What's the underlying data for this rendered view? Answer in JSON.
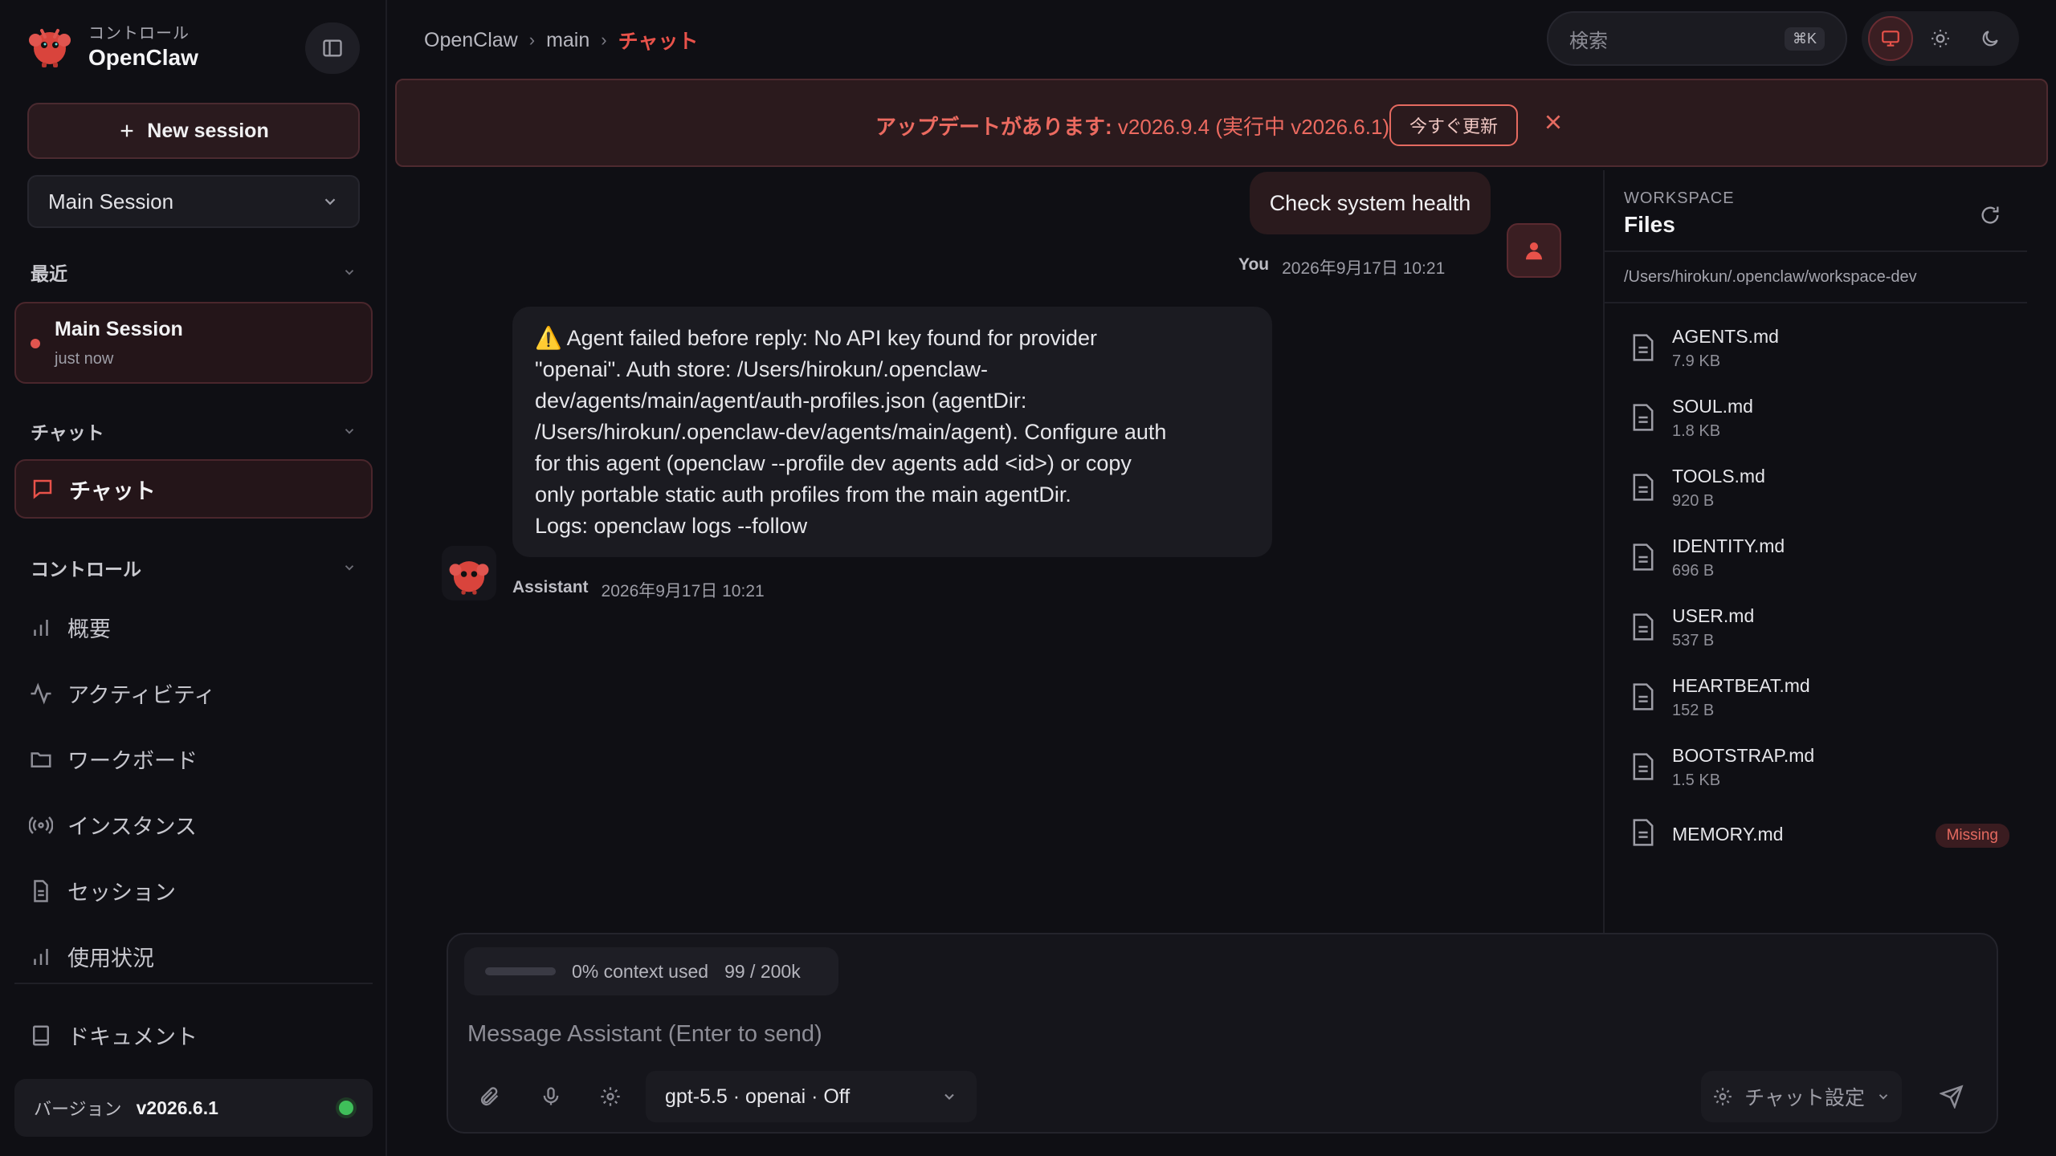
{
  "brand": {
    "subtitle": "コントロール",
    "title": "OpenClaw"
  },
  "sidebar": {
    "new_session_label": "New session",
    "session_select_value": "Main Session",
    "recent": {
      "heading": "最近",
      "item": {
        "title": "Main Session",
        "time": "just now"
      }
    },
    "chat": {
      "heading": "チャット",
      "item_label": "チャット"
    },
    "control": {
      "heading": "コントロール",
      "items": [
        {
          "label": "概要",
          "icon": "bar-chart-icon"
        },
        {
          "label": "アクティビティ",
          "icon": "activity-icon"
        },
        {
          "label": "ワークボード",
          "icon": "folder-icon"
        },
        {
          "label": "インスタンス",
          "icon": "broadcast-icon"
        },
        {
          "label": "セッション",
          "icon": "document-icon"
        },
        {
          "label": "使用状況",
          "icon": "bar-chart-icon"
        }
      ]
    },
    "docs_label": "ドキュメント",
    "version": {
      "label": "バージョン",
      "value": "v2026.6.1",
      "status_color": "#3fbf5a"
    }
  },
  "breadcrumb": {
    "items": [
      "OpenClaw",
      "main"
    ],
    "current": "チャット",
    "separator": "›"
  },
  "search": {
    "placeholder": "検索",
    "shortcut": "⌘K"
  },
  "theme": {
    "options": [
      "desktop-icon",
      "sun-icon",
      "moon-icon"
    ],
    "active": "desktop-icon"
  },
  "banner": {
    "prefix": "アップデートがあります:",
    "message": " v2026.9.4 (実行中 v2026.6.1).",
    "button_label": "今すぐ更新"
  },
  "chat": {
    "user_message": {
      "text": "Check system health",
      "author": "You",
      "time": "2026年9月17日 10:21"
    },
    "assistant_message": {
      "lines": [
        "⚠️ Agent failed before reply: No API key found for provider",
        "\"openai\". Auth store: /Users/hirokun/.openclaw-",
        "dev/agents/main/agent/auth-profiles.json (agentDir:",
        "/Users/hirokun/.openclaw-dev/agents/main/agent). Configure auth",
        "for this agent (openclaw --profile dev agents add <id>) or copy",
        "only portable static auth profiles from the main agentDir.",
        "Logs: openclaw logs --follow"
      ],
      "author": "Assistant",
      "time": "2026年9月17日 10:21"
    }
  },
  "workspace": {
    "label": "WORKSPACE",
    "title": "Files",
    "path": "/Users/hirokun/.openclaw/workspace-dev",
    "files": [
      {
        "name": "AGENTS.md",
        "size": "7.9 KB"
      },
      {
        "name": "SOUL.md",
        "size": "1.8 KB"
      },
      {
        "name": "TOOLS.md",
        "size": "920 B"
      },
      {
        "name": "IDENTITY.md",
        "size": "696 B"
      },
      {
        "name": "USER.md",
        "size": "537 B"
      },
      {
        "name": "HEARTBEAT.md",
        "size": "152 B"
      },
      {
        "name": "BOOTSTRAP.md",
        "size": "1.5 KB"
      },
      {
        "name": "MEMORY.md",
        "size": "",
        "badge": "Missing"
      }
    ]
  },
  "composer": {
    "context_percent": 0,
    "context_label": "0% context used",
    "context_tokens": "99 / 200k",
    "placeholder": "Message Assistant (Enter to send)",
    "model_value": "gpt-5.5 · openai · Off",
    "settings_label": "チャット設定"
  },
  "colors": {
    "accent": "#e8524a",
    "background": "#0f0f14",
    "panel": "#1b1b21"
  }
}
